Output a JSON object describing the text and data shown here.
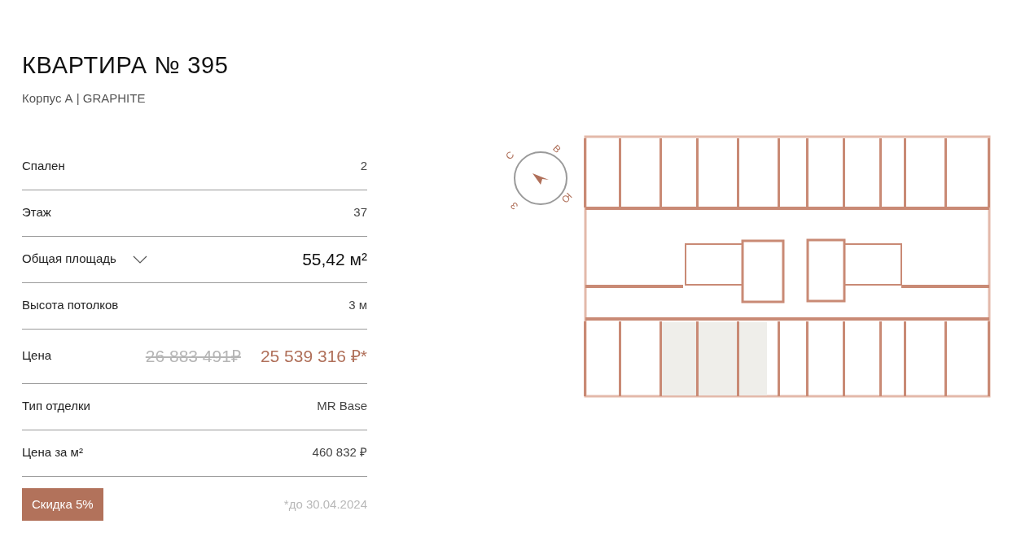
{
  "title": "КВАРТИРА № 395",
  "subtitle": "Корпус А | GRAPHITE",
  "specs": [
    {
      "kind": "plain",
      "label": "Спален",
      "value": "2"
    },
    {
      "kind": "plain",
      "label": "Этаж",
      "value": "37"
    },
    {
      "kind": "area",
      "label": "Общая площадь",
      "value": "55,42 м²",
      "expanded": false
    },
    {
      "kind": "plain",
      "label": "Высота потолков",
      "value": "3 м"
    },
    {
      "kind": "price",
      "label": "Цена",
      "old_value": "26 883 491₽",
      "value": "25 539 316 ₽*"
    },
    {
      "kind": "plain",
      "label": "Тип отделки",
      "value": "MR Base"
    },
    {
      "kind": "plain",
      "label": "Цена за м²",
      "value": "460 832 ₽"
    }
  ],
  "discount": {
    "badge": "Скидка 5%",
    "note": "*до 30.04.2024"
  },
  "compass": {
    "north": "С",
    "east": "В",
    "south": "Ю",
    "west": "З"
  }
}
